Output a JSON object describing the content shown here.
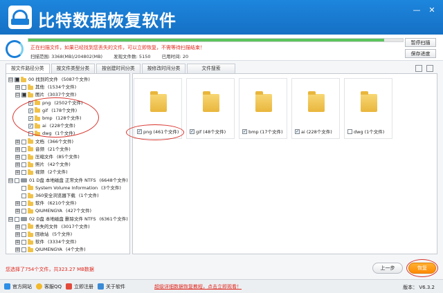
{
  "app": {
    "title": "比特数据恢复软件",
    "brand_color": "#1a7fd8",
    "minimize": "—",
    "close": "✕"
  },
  "scan": {
    "progress": 0.95,
    "message": "正在扫描文件，如果已经找到您丢失的文件，可以立即恢复，不需等待扫描结束！",
    "range": "扫描范围: 3368(MB)/204802(MB)",
    "found": "发现文件数: 5150",
    "time": "已用时间: 20",
    "pause_label": "暂停扫描",
    "save_label": "保存进度"
  },
  "tabs": [
    {
      "label": "按文件路径分类"
    },
    {
      "label": "按文件类型分类"
    },
    {
      "label": "按创建时间分类"
    },
    {
      "label": "按修改时间分类"
    },
    {
      "label": "文件搜索"
    }
  ],
  "tree": [
    {
      "label": "00 找到的文件",
      "count": "(5087个文件)",
      "exp": "⊟",
      "cb": "■",
      "type": "folder",
      "indent": 0
    },
    {
      "label": "其他",
      "count": "(1534个文件)",
      "exp": "⊞",
      "cb": "",
      "type": "folder",
      "indent": 1
    },
    {
      "label": "图片",
      "count": "(3037个文件)",
      "exp": "⊟",
      "cb": "■",
      "type": "folder",
      "indent": 1
    },
    {
      "label": "png",
      "count": "(2502个文件)",
      "exp": "",
      "cb": "✓",
      "type": "folder",
      "indent": 2
    },
    {
      "label": "gif",
      "count": "(178个文件)",
      "exp": "",
      "cb": "✓",
      "type": "folder",
      "indent": 2
    },
    {
      "label": "bmp",
      "count": "(128个文件)",
      "exp": "",
      "cb": "✓",
      "type": "folder",
      "indent": 2
    },
    {
      "label": "ai",
      "count": "(228个文件)",
      "exp": "",
      "cb": "✓",
      "type": "folder",
      "indent": 2
    },
    {
      "label": "dwg",
      "count": "(1个文件)",
      "exp": "",
      "cb": "",
      "type": "folder",
      "indent": 2
    },
    {
      "label": "文档",
      "count": "(366个文件)",
      "exp": "⊞",
      "cb": "",
      "type": "folder",
      "indent": 1
    },
    {
      "label": "音频",
      "count": "(21个文件)",
      "exp": "⊞",
      "cb": "",
      "type": "folder",
      "indent": 1
    },
    {
      "label": "压缩文件",
      "count": "(85个文件)",
      "exp": "⊞",
      "cb": "",
      "type": "folder",
      "indent": 1
    },
    {
      "label": "照片",
      "count": "(42个文件)",
      "exp": "⊞",
      "cb": "",
      "type": "folder",
      "indent": 1
    },
    {
      "label": "视频",
      "count": "(2个文件)",
      "exp": "⊞",
      "cb": "",
      "type": "folder",
      "indent": 1
    },
    {
      "label": "01 D盘 本地磁盘 正常文件 NTFS",
      "count": "(6648个文件)",
      "exp": "⊟",
      "cb": "",
      "type": "drive",
      "indent": 0
    },
    {
      "label": "System Volume Information",
      "count": "(3个文件)",
      "exp": "",
      "cb": "",
      "type": "folder",
      "indent": 1
    },
    {
      "label": "360安全浏览器下载",
      "count": "(1个文件)",
      "exp": "",
      "cb": "",
      "type": "folder",
      "indent": 1
    },
    {
      "label": "软件",
      "count": "(6210个文件)",
      "exp": "⊞",
      "cb": "",
      "type": "folder",
      "indent": 1
    },
    {
      "label": "QIUMENGYA",
      "count": "(427个文件)",
      "exp": "⊞",
      "cb": "",
      "type": "folder",
      "indent": 1
    },
    {
      "label": "02 D盘 本地磁盘 删除文件 NTFS",
      "count": "(6361个文件)",
      "exp": "⊟",
      "cb": "",
      "type": "drive",
      "indent": 0
    },
    {
      "label": "丢失的文件",
      "count": "(3017个文件)",
      "exp": "⊞",
      "cb": "",
      "type": "folder",
      "indent": 1
    },
    {
      "label": "回收站",
      "count": "(5个文件)",
      "exp": "⊞",
      "cb": "",
      "type": "folder",
      "indent": 1
    },
    {
      "label": "软件",
      "count": "(3334个文件)",
      "exp": "⊞",
      "cb": "",
      "type": "folder",
      "indent": 1
    },
    {
      "label": "QIUMENGYA",
      "count": "(4个文件)",
      "exp": "⊞",
      "cb": "",
      "type": "folder",
      "indent": 1
    }
  ],
  "grid": [
    {
      "label": "png (461个文件)",
      "cb": "✓"
    },
    {
      "label": "gif (48个文件)",
      "cb": "✓"
    },
    {
      "label": "bmp (17个文件)",
      "cb": "✓"
    },
    {
      "label": "ai (228个文件)",
      "cb": "✓"
    },
    {
      "label": "dwg (1个文件)",
      "cb": ""
    }
  ],
  "status": {
    "selected": "您选择了754个文件，共323.27 MB数据"
  },
  "buttons": {
    "prev": "上一步",
    "restore": "恢复"
  },
  "footer": {
    "site": "官方网站",
    "qq": "客服QQ",
    "register": "立即注册",
    "about": "关于软件",
    "link": "超级详细数据恢复教程，点击立即观看！",
    "version": "版本： V6.3.2"
  }
}
